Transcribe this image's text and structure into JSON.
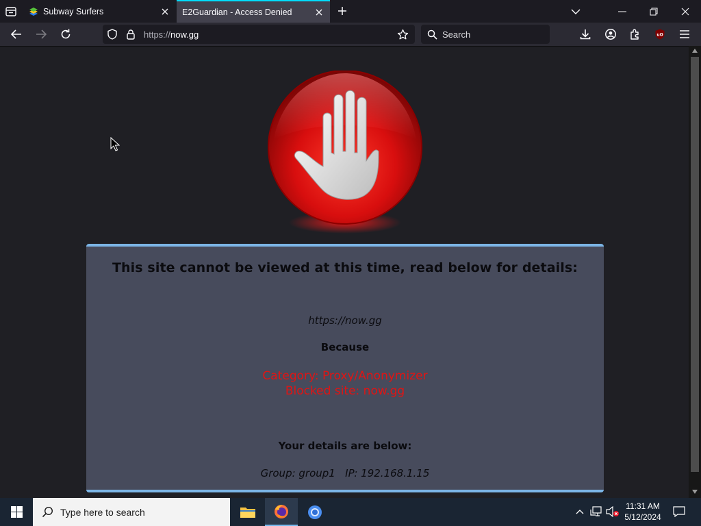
{
  "browser": {
    "tabs": [
      {
        "title": "Subway Surfers",
        "active": false,
        "favicon": "bluestacks-icon"
      },
      {
        "title": "E2Guardian - Access Denied",
        "active": true
      }
    ],
    "url": {
      "scheme": "https://",
      "host": "now.gg"
    },
    "search_placeholder": "Search"
  },
  "page": {
    "heading": "This site cannot be viewed at this time, read below for details:",
    "blocked_url": "https://now.gg",
    "because_label": "Because",
    "category_line": "Category: Proxy/Anonymizer",
    "blocked_line": "Blocked site: now.gg",
    "details_label": "Your details are below:",
    "group_line": "Group: group1   IP: 192.168.1.15",
    "colors": {
      "panel": "#474b5c",
      "border": "#7cb5e6",
      "alert": "#e01414",
      "stop": "#d01010"
    }
  },
  "taskbar": {
    "search_placeholder": "Type here to search",
    "time": "11:31 AM",
    "date": "5/12/2024"
  }
}
